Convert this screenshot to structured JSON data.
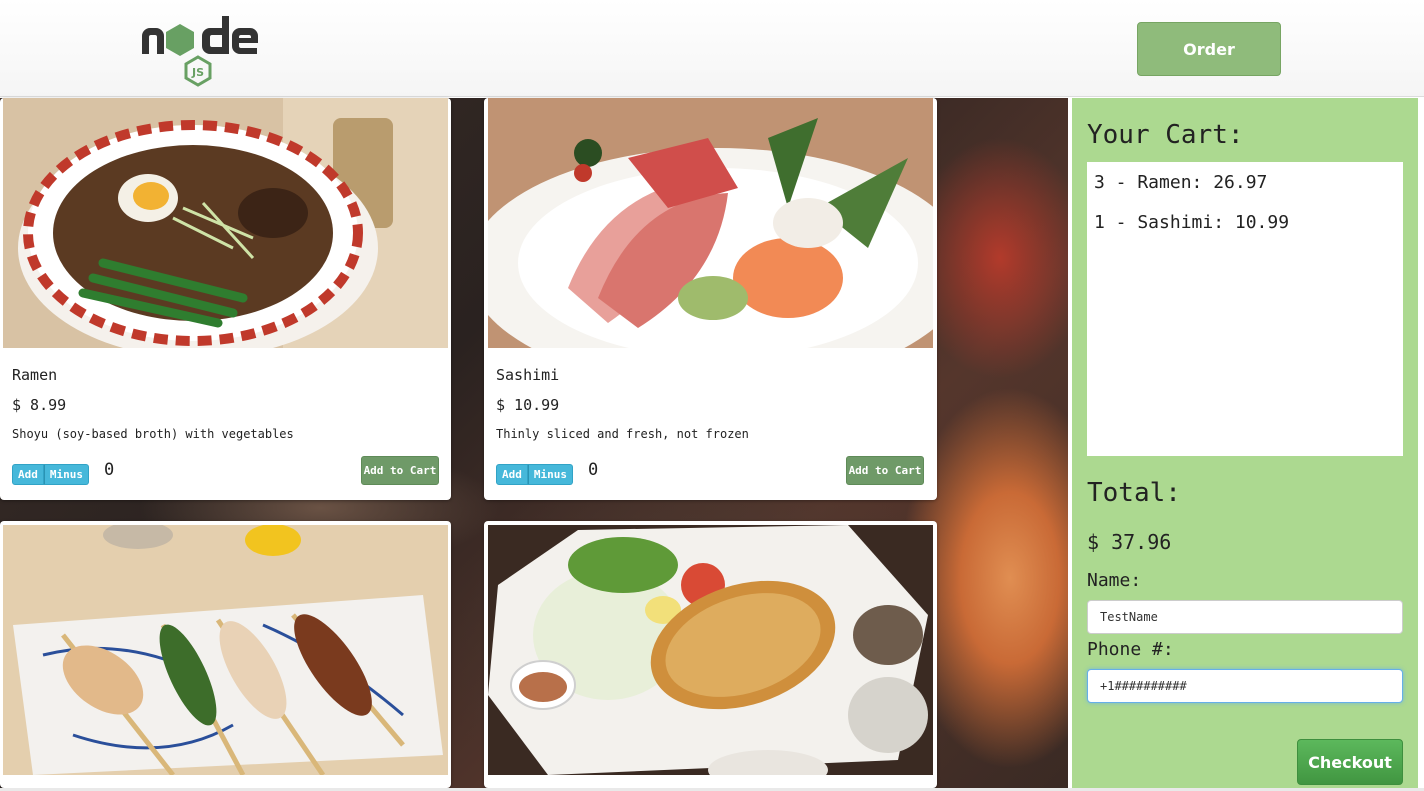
{
  "header": {
    "logo_text": "node",
    "logo_badge": "JS",
    "order_label": "Order"
  },
  "menu_items": [
    {
      "name": "Ramen",
      "price": "$ 8.99",
      "description": "Shoyu (soy-based broth) with vegetables",
      "add_label": "Add",
      "minus_label": "Minus",
      "quantity": "0",
      "add_to_cart_label": "Add to Cart"
    },
    {
      "name": "Sashimi",
      "price": "$ 10.99",
      "description": "Thinly sliced and fresh, not frozen",
      "add_label": "Add",
      "minus_label": "Minus",
      "quantity": "0",
      "add_to_cart_label": "Add to Cart"
    }
  ],
  "cart": {
    "title": "Your Cart:",
    "items": [
      "3 - Ramen: 26.97",
      "1 - Sashimi: 10.99"
    ],
    "total_label": "Total:",
    "total_value": "$ 37.96",
    "name_label": "Name:",
    "name_value": "TestName",
    "phone_label": "Phone #:",
    "phone_value": "+1##########",
    "checkout_label": "Checkout"
  },
  "colors": {
    "cart_bg": "#acd990",
    "order_button": "#8fbb7b",
    "add_to_cart_button": "#6f9a68",
    "info_button": "#46b8da",
    "checkout_button": "#4cae4c"
  }
}
